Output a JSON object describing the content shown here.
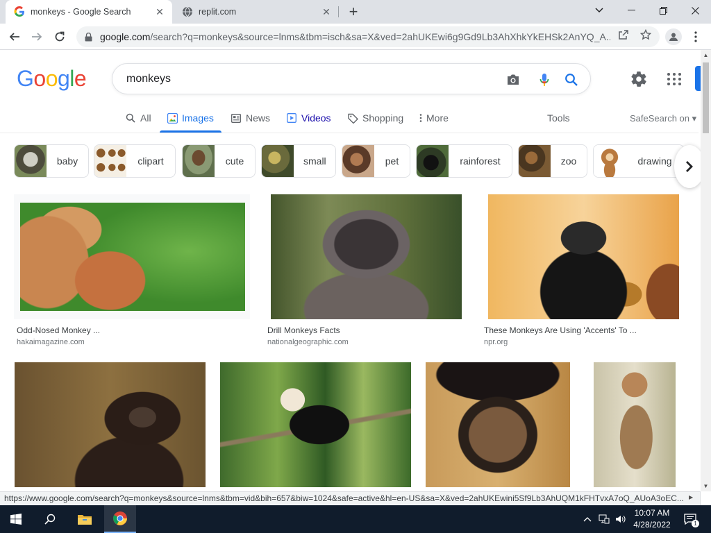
{
  "browser": {
    "active_tab_title": "monkeys - Google Search",
    "inactive_tab_title": "replit.com",
    "url_host": "google.com",
    "url_rest": "/search?q=monkeys&source=lnms&tbm=isch&sa=X&ved=2ahUKEwi6g9Gd9Lb3AhXhkYkEHSk2AnYQ_A..."
  },
  "search": {
    "query": "monkeys"
  },
  "logo": [
    "G",
    "o",
    "o",
    "g",
    "l",
    "e"
  ],
  "nav_tabs": {
    "all": "All",
    "images": "Images",
    "news": "News",
    "videos": "Videos",
    "shopping": "Shopping",
    "more": "More",
    "tools": "Tools",
    "safesearch": "SafeSearch on"
  },
  "chips": [
    {
      "label": "baby"
    },
    {
      "label": "clipart"
    },
    {
      "label": "cute"
    },
    {
      "label": "small"
    },
    {
      "label": "pet"
    },
    {
      "label": "rainforest"
    },
    {
      "label": "zoo"
    },
    {
      "label": "drawing"
    }
  ],
  "results": [
    {
      "title": "Odd-Nosed Monkey ...",
      "site": "hakaimagazine.com"
    },
    {
      "title": "Drill Monkeys Facts",
      "site": "nationalgeographic.com"
    },
    {
      "title": "These Monkeys Are Using 'Accents' To ...",
      "site": "npr.org"
    },
    {
      "title": "",
      "site": ""
    },
    {
      "title": "",
      "site": ""
    },
    {
      "title": "",
      "site": ""
    },
    {
      "title": "",
      "site": ""
    }
  ],
  "status_url": "https://www.google.com/search?q=monkeys&source=lnms&tbm=vid&bih=657&biw=1024&safe=active&hl=en-US&sa=X&ved=2ahUKEwini5Sf9Lb3AhUQM1kFHTvxA7oQ_AUoA3oEC...",
  "taskbar": {
    "time": "10:07 AM",
    "date": "4/28/2022",
    "notification_count": "1"
  },
  "colors": {
    "google_blue": "#4285f4",
    "google_red": "#ea4335",
    "google_yellow": "#fbbc05",
    "google_green": "#34a853",
    "active_tab_accent": "#1a73e8",
    "taskbar_bg": "#101c2c"
  }
}
